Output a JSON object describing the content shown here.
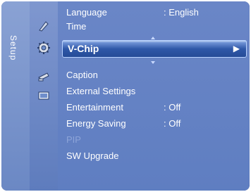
{
  "sidebar": {
    "title": "Setup"
  },
  "menu": {
    "items": [
      {
        "label": "Language",
        "value": ": English"
      },
      {
        "label": "Time",
        "value": ""
      },
      {
        "label": "V-Chip",
        "value": "",
        "selected": true,
        "arrow": "▶"
      },
      {
        "label": "Caption",
        "value": ""
      },
      {
        "label": "External Settings",
        "value": ""
      },
      {
        "label": "Entertainment",
        "value": ": Off"
      },
      {
        "label": "Energy Saving",
        "value": ": Off"
      },
      {
        "label": "PIP",
        "value": "",
        "disabled": true
      },
      {
        "label": "SW Upgrade",
        "value": ""
      }
    ]
  },
  "icons": [
    "picture-icon",
    "setup-icon",
    "input-icon",
    "application-icon"
  ]
}
